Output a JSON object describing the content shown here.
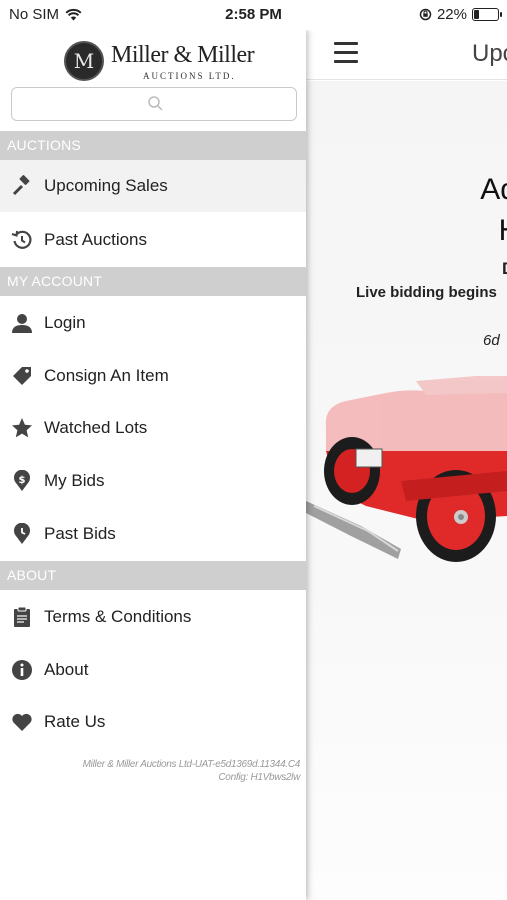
{
  "status_bar": {
    "carrier": "No SIM",
    "time": "2:58 PM",
    "battery": "22%",
    "battery_level": 0.22
  },
  "header": {
    "title": "Upco"
  },
  "auction": {
    "title_line1": "Advert",
    "title_line2": "Histo",
    "date_fragment": "D",
    "live_text": "Live bidding begins",
    "countdown": "6d"
  },
  "logo": {
    "name": "Miller & Miller",
    "subtitle": "AUCTIONS LTD."
  },
  "search": {
    "placeholder": ""
  },
  "sections": {
    "auctions": "AUCTIONS",
    "my_account": "MY ACCOUNT",
    "about": "ABOUT"
  },
  "menu": {
    "upcoming_sales": "Upcoming Sales",
    "past_auctions": "Past Auctions",
    "login": "Login",
    "consign": "Consign An Item",
    "watched": "Watched Lots",
    "my_bids": "My Bids",
    "past_bids": "Past Bids",
    "terms": "Terms & Conditions",
    "about": "About",
    "rate": "Rate Us"
  },
  "footer": {
    "version": "Miller & Miller Auctions Ltd-UAT-e5d1369d.11344.C4",
    "config": "Config: H1Vbws2lw"
  },
  "icons": {
    "wifi": "wifi-icon",
    "menu": "hamburger-icon",
    "search": "search-icon",
    "gavel": "gavel-icon",
    "history": "history-icon",
    "user": "user-icon",
    "tag": "tag-icon",
    "star": "star-icon",
    "dollar_pin": "dollar-pin-icon",
    "clock_pin": "clock-pin-icon",
    "clipboard": "clipboard-icon",
    "info": "info-icon",
    "heart": "heart-icon"
  }
}
